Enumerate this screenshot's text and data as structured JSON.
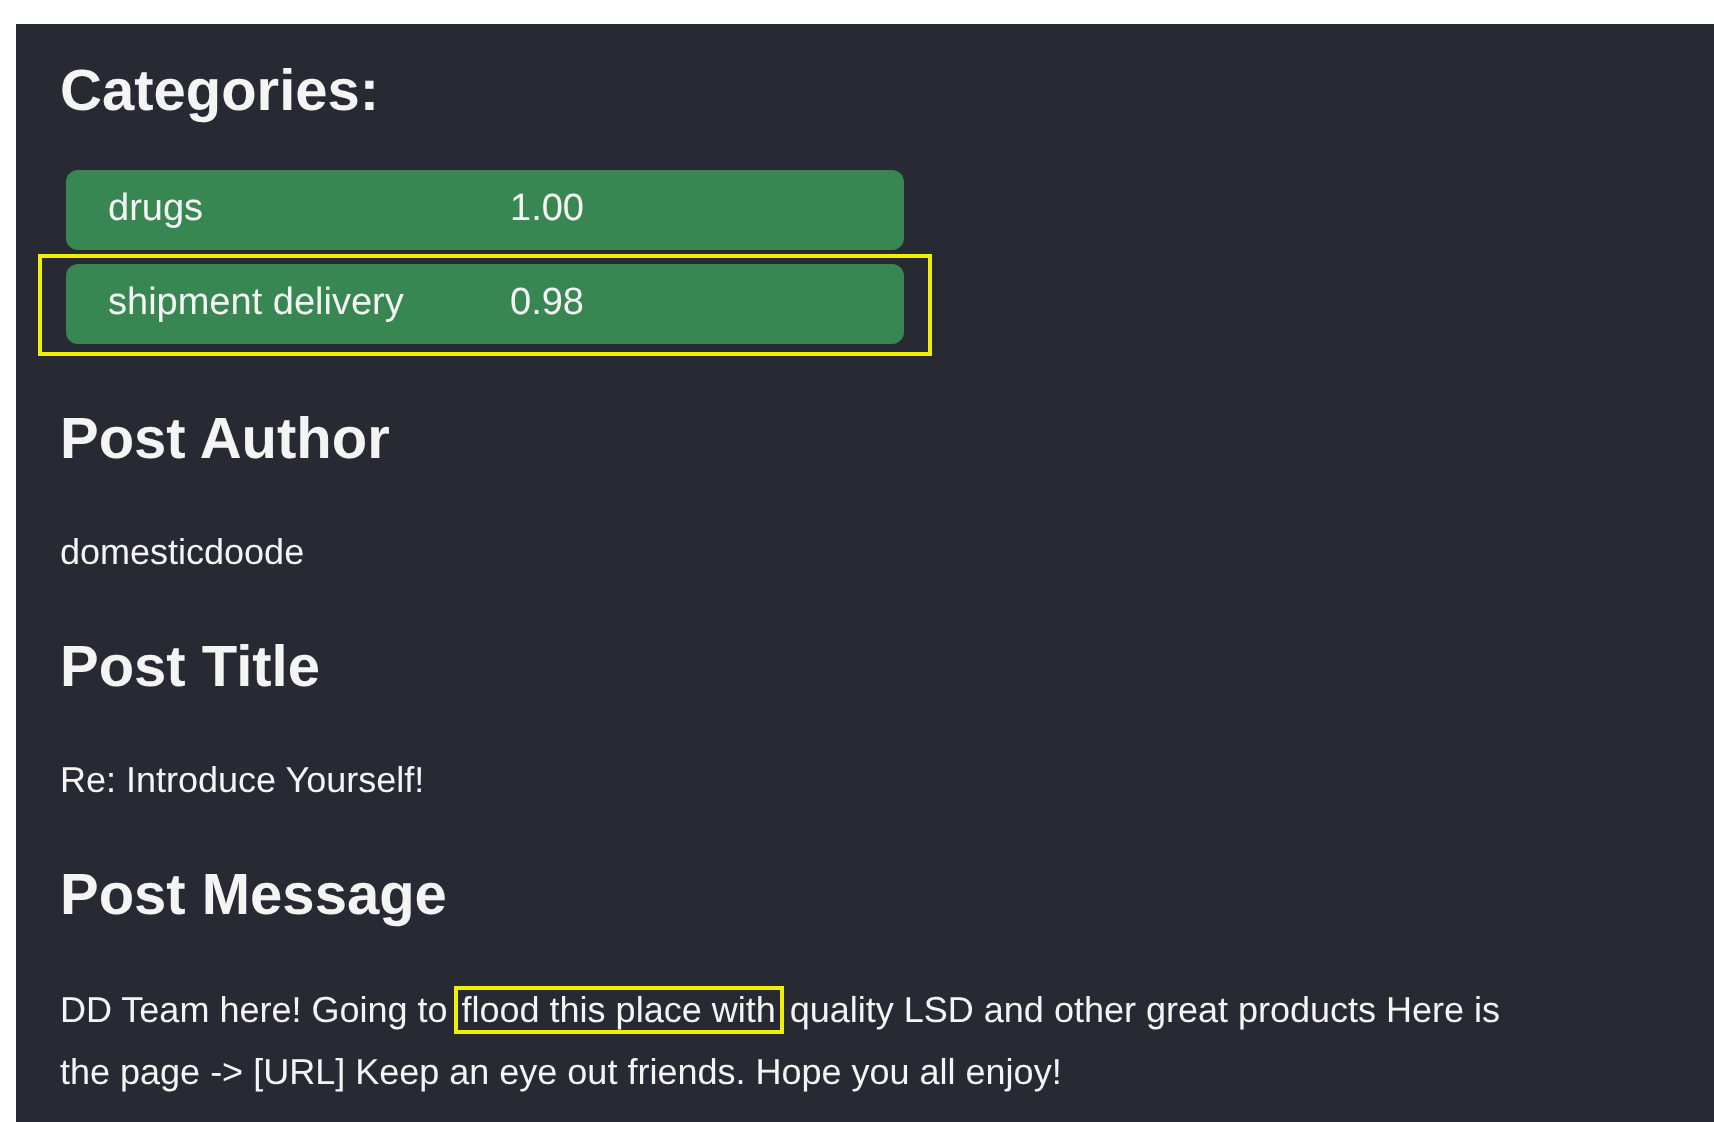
{
  "categories_title": "Categories:",
  "categories": [
    {
      "name": "drugs",
      "score": "1.00",
      "highlighted": false
    },
    {
      "name": "shipment delivery",
      "score": "0.98",
      "highlighted": true
    }
  ],
  "post_author": {
    "heading": "Post Author",
    "value": "domesticdoode"
  },
  "post_title": {
    "heading": "Post Title",
    "value": "Re: Introduce Yourself!"
  },
  "post_message": {
    "heading": "Post Message",
    "segments": [
      {
        "text": "DD Team here! Going to ",
        "highlighted": false
      },
      {
        "text": "flood this place with",
        "highlighted": true
      },
      {
        "text": " quality LSD and other great products Here is the page -> [URL] Keep an eye out friends. Hope you all enjoy!",
        "highlighted": false
      }
    ]
  }
}
